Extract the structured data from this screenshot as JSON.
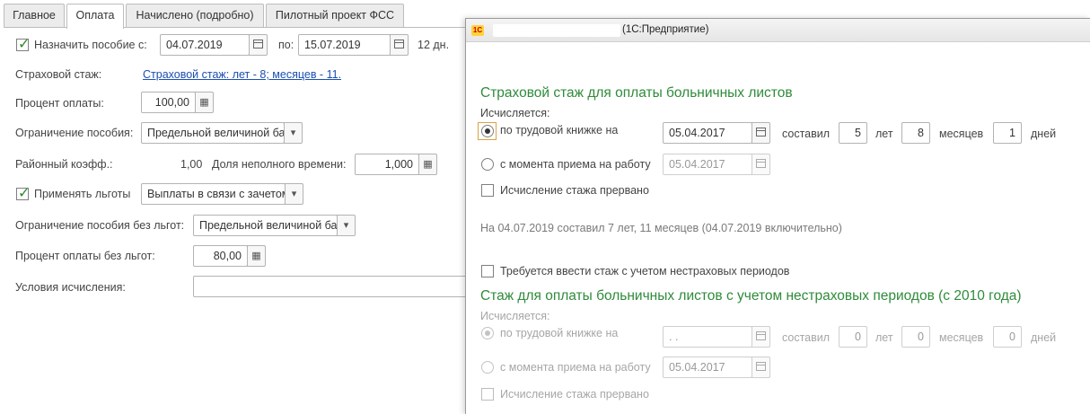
{
  "tabs": [
    "Главное",
    "Оплата",
    "Начислено (подробно)",
    "Пилотный проект ФСС"
  ],
  "left": {
    "assign_label": "Назначить пособие с:",
    "assign_from": "04.07.2019",
    "to_label": "по:",
    "assign_to": "15.07.2019",
    "days": "12 дн.",
    "insurance_label": "Страховой стаж:",
    "insurance_link": "Страховой стаж: лет - 8; месяцев - 11.",
    "pay_percent_label": "Процент оплаты:",
    "pay_percent": "100,00",
    "limit_label": "Ограничение пособия:",
    "limit_value": "Предельной величиной ба",
    "regional_label": "Районный коэфф.:",
    "regional_value": "1,00",
    "parttime_label": "Доля неполного времени:",
    "parttime_value": "1,000",
    "benefits_label": "Применять льготы",
    "benefits_value": "Выплаты в связи с зачетом",
    "limit_nobenefits_label": "Ограничение пособия без льгот:",
    "limit_nobenefits_value": "Предельной величиной ба",
    "pay_percent_nobenefits_label": "Процент оплаты без льгот:",
    "pay_percent_nobenefits": "80,00",
    "conditions_label": "Условия исчисления:",
    "conditions_value": ""
  },
  "dialog": {
    "logo": "1С",
    "title": "(1С:Предприятие)",
    "section1": {
      "heading": "Страховой стаж для оплаты больничных листов",
      "calculated_label": "Исчисляется:",
      "opt_workbook": "по трудовой книжке на",
      "workbook_date": "05.04.2017",
      "made_label": "составил",
      "years": "5",
      "years_label": "лет",
      "months": "8",
      "months_label": "месяцев",
      "days": "1",
      "days_label": "дней",
      "opt_hire": "с момента приема на работу",
      "hire_date": "05.04.2017",
      "interrupted": "Исчисление стажа прервано",
      "summary": "На 04.07.2019 составил 7 лет, 11 месяцев (04.07.2019 включительно)"
    },
    "nonins_check": "Требуется ввести стаж с учетом нестраховых периодов",
    "section2": {
      "heading": "Стаж для оплаты больничных листов с учетом нестраховых периодов (с 2010 года)",
      "calculated_label": "Исчисляется:",
      "opt_workbook": "по трудовой книжке на",
      "workbook_date": " .  .",
      "made_label": "составил",
      "years": "0",
      "years_label": "лет",
      "months": "0",
      "months_label": "месяцев",
      "days": "0",
      "days_label": "дней",
      "opt_hire": "с момента приема на работу",
      "hire_date": "05.04.2017",
      "interrupted": "Исчисление стажа прервано"
    }
  }
}
